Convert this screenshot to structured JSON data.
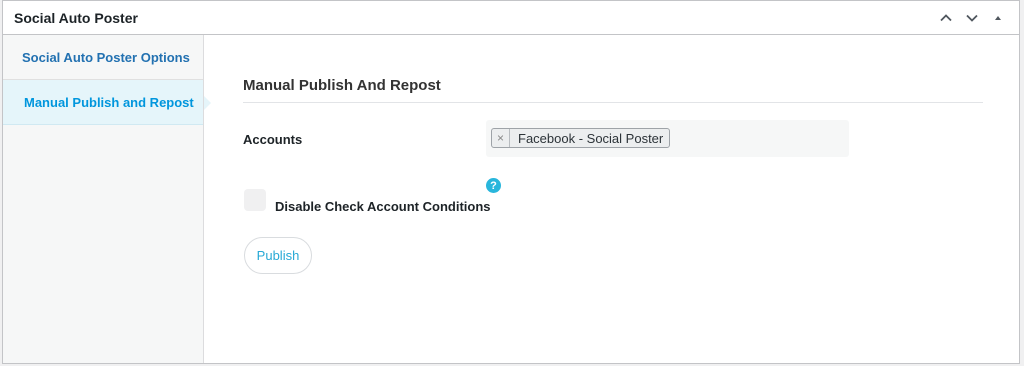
{
  "metabox": {
    "title": "Social Auto Poster"
  },
  "tabs": [
    {
      "label": "Social Auto Poster Options"
    },
    {
      "label": "Manual Publish and Repost"
    }
  ],
  "panel": {
    "section_title": "Manual Publish And Repost",
    "accounts": {
      "label": "Accounts",
      "selected": [
        {
          "remove_glyph": "×",
          "label": "Facebook - Social Poster"
        }
      ]
    },
    "disable_check": {
      "label": "Disable Check Account Conditions",
      "checked": false,
      "help_glyph": "?"
    },
    "publish_label": "Publish"
  },
  "icons": {
    "move_up": "chevron-up-icon",
    "move_down": "chevron-down-icon",
    "toggle": "triangle-up-icon",
    "help": "question-circle-icon"
  },
  "colors": {
    "accent": "#0096dd",
    "help": "#29b6dc",
    "link": "#2271b1"
  }
}
